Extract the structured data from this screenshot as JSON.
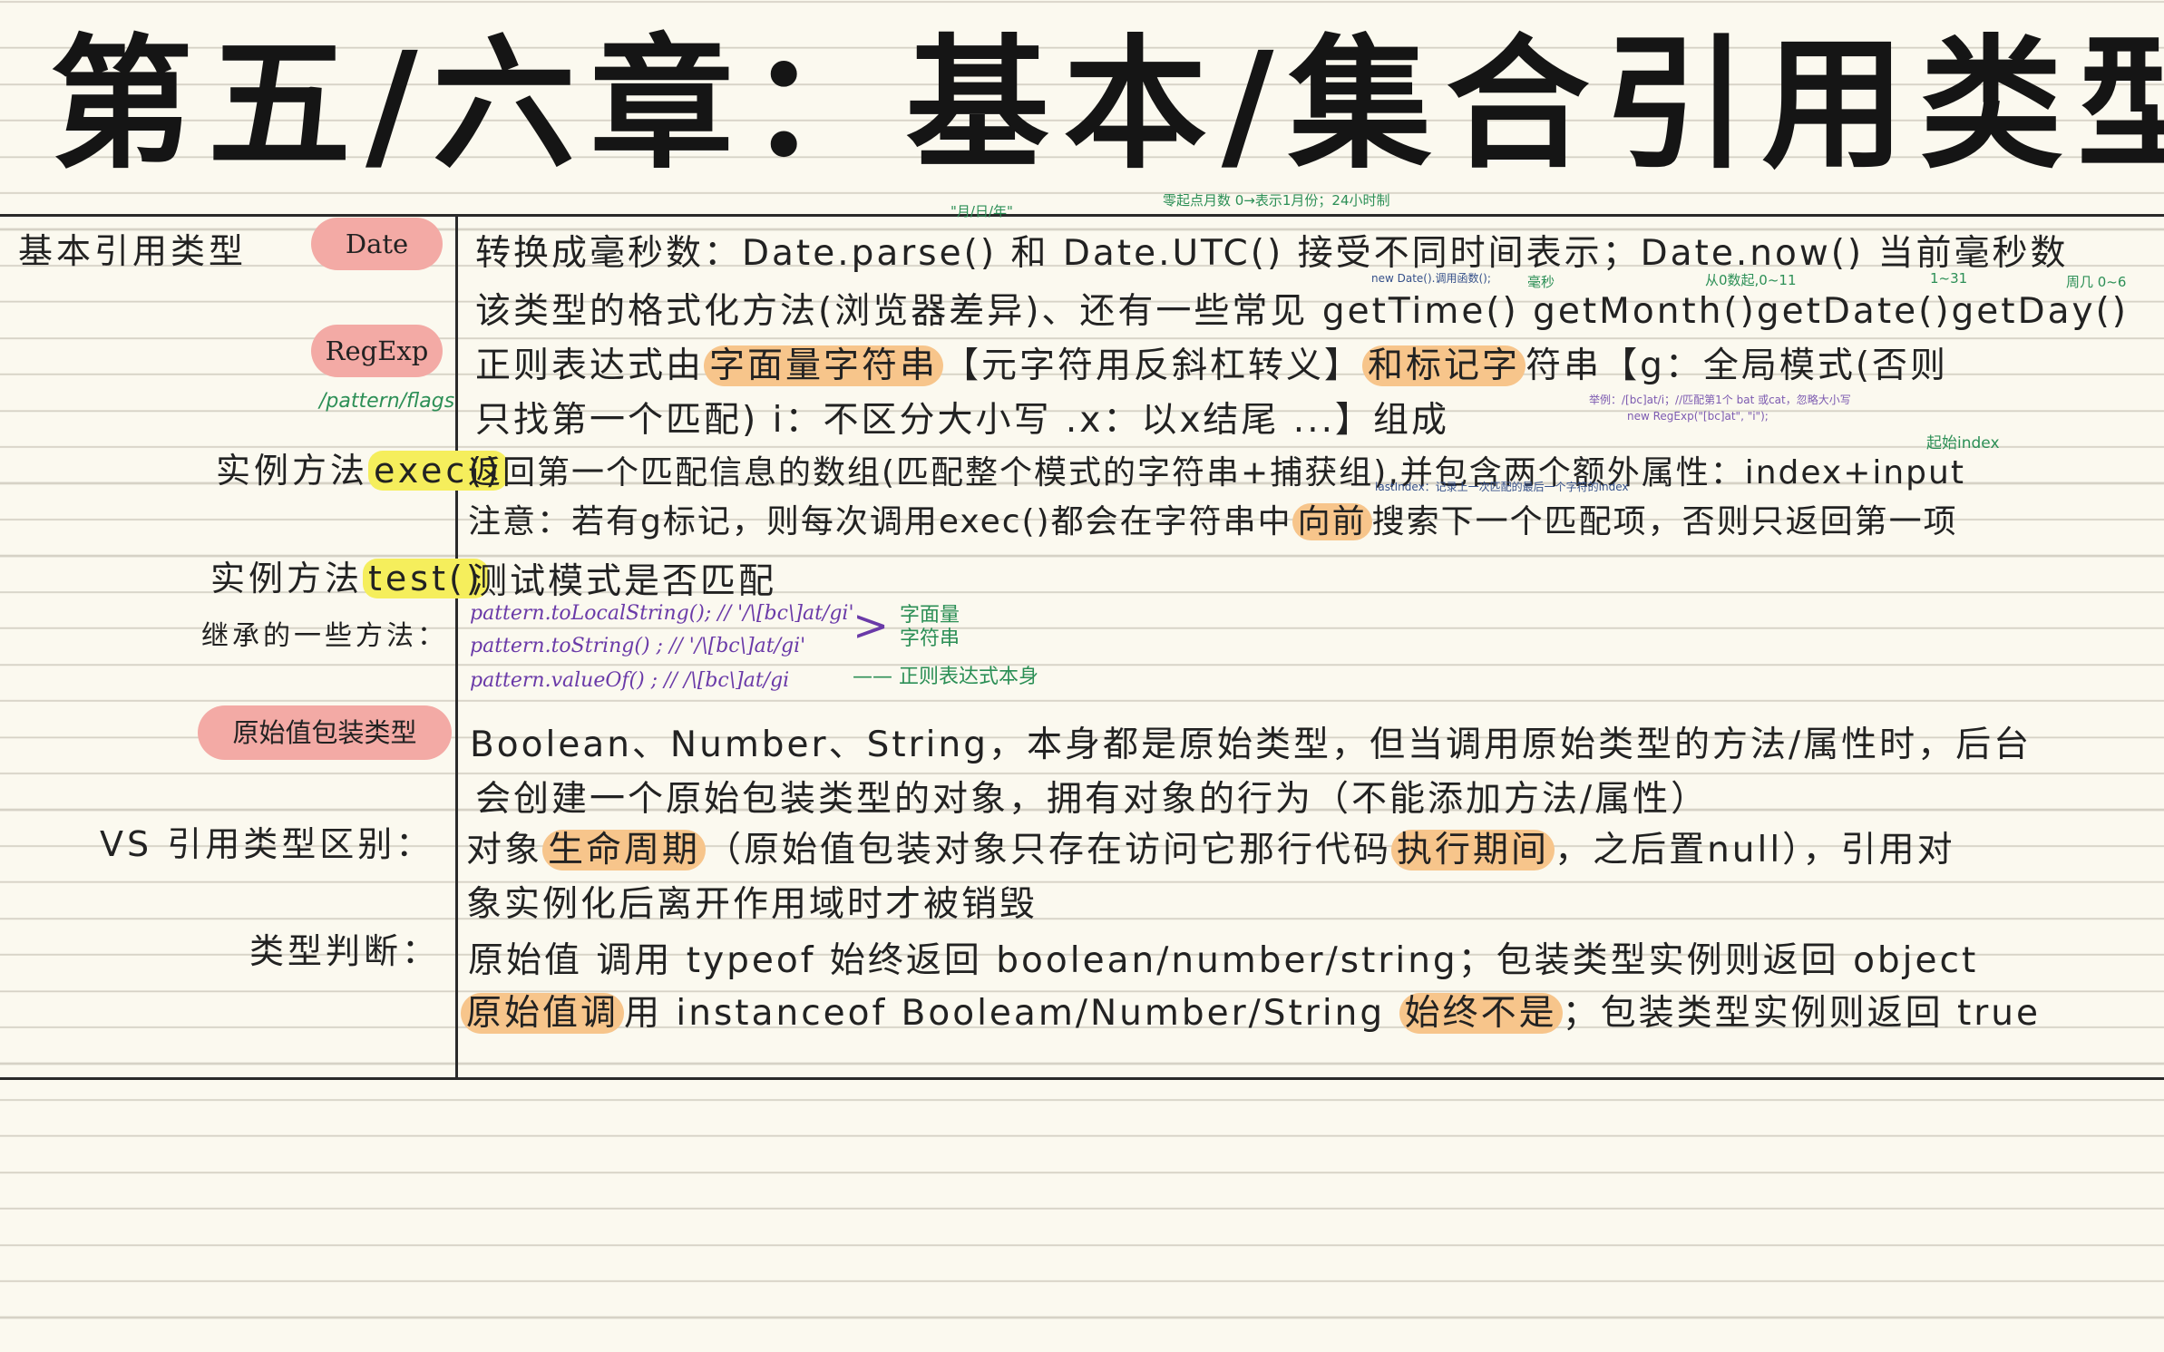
{
  "title": "第五/六章：基本/集合引用类型",
  "labels": {
    "basic_ref": "基本引用类型",
    "date_pill": "Date",
    "regexp_pill": "RegExp",
    "pattern_flags": "/pattern/flags",
    "exec_prefix": "实例方法",
    "exec_hl": "exec()",
    "test_prefix": "实例方法",
    "test_hl": "test()",
    "inherited": "继承的一些方法：",
    "wrapper_pill": "原始值包装类型",
    "vs": "VS 引用类型区别：",
    "type_check": "类型判断："
  },
  "rows": {
    "date1": {
      "a": "转换成毫秒数：Date.parse()",
      "b": "和 Date.UTC()",
      "c": "接受不同时间表示；Date.now() 当前毫秒数"
    },
    "date2": "该类型的格式化方法(浏览器差异)、还有一些常见 getTime() getMonth()getDate()getDay()",
    "regexp1": {
      "a": "正则表达式由",
      "b": "字面量字符串",
      "c": "【元字符用反斜杠转义】",
      "d": "和标记字",
      "e": "符串【g：全局模式(否则"
    },
    "regexp2": "只找第一个匹配) i：不区分大小写 .x：以x结尾 ...】组成",
    "exec1": "返回第一个匹配信息的数组(匹配整个模式的字符串+捕获组),并包含两个额外属性：index+input",
    "exec2": {
      "a": "注意：若有g标记，则每次调用exec()都会在字符串中",
      "b": "向前",
      "c": "搜索下一个匹配项，否则只返回第一项"
    },
    "test": "测试模式是否匹配",
    "wrap1": "Boolean、Number、String，本身都是原始类型，但当调用原始类型的方法/属性时，后台",
    "wrap2": "会创建一个原始包装类型的对象，拥有对象的行为（不能添加方法/属性）",
    "vs1": {
      "a": "对象",
      "b": "生命周期",
      "c": "（原始值包装对象只存在访问它那行代码",
      "d": "执行期间",
      "e": "，之后置null），引用对"
    },
    "vs2": "象实例化后离开作用域时才被销毁",
    "tc1": "原始值 调用 typeof 始终返回 boolean/number/string；包装类型实例则返回 object",
    "tc2": {
      "a": "原始值调",
      "b": "用 instanceof Booleam/Number/String",
      "c": "始终不是",
      "d": "；包装类型实例则返回 true"
    }
  },
  "code": {
    "l1": "pattern.toLocalString();  //  '/\\[bc\\]at/gi'",
    "l2": "pattern.toString()        ;  //  '/\\[bc\\]at/gi'",
    "l3": "pattern.valueOf()         ;  //  /\\[bc\\]at/gi",
    "brace_note1": "字面量",
    "brace_note2": "字符串",
    "l3_note": "—— 正则表达式本身"
  },
  "notes": {
    "yyyy": "\"月/日/年\"",
    "zero_month": "零起点月数 0→表示1月份；24小时制",
    "new_date": "new Date().调用函数();",
    "ms": "毫秒",
    "from_zero": "从0数起,0~11",
    "one_31": "1~31",
    "week": "周几 0~6",
    "eg1": "举例：/[bc]at/i；//匹配第1个 bat 或cat，忽略大小写",
    "eg2": "new RegExp(\"[bc]at\", \"i\");",
    "start_index": "起始index",
    "last_index": "lastIndex：记录上一次匹配的最后一个字符的index"
  },
  "colors": {
    "paper": "#fbf9ef",
    "pill": "#f3aaa5",
    "orange_highlight": "#f7c58b",
    "yellow_highlight": "#f5ee5c",
    "note_green": "#2c8f56",
    "code_purple": "#6a3aa8"
  }
}
